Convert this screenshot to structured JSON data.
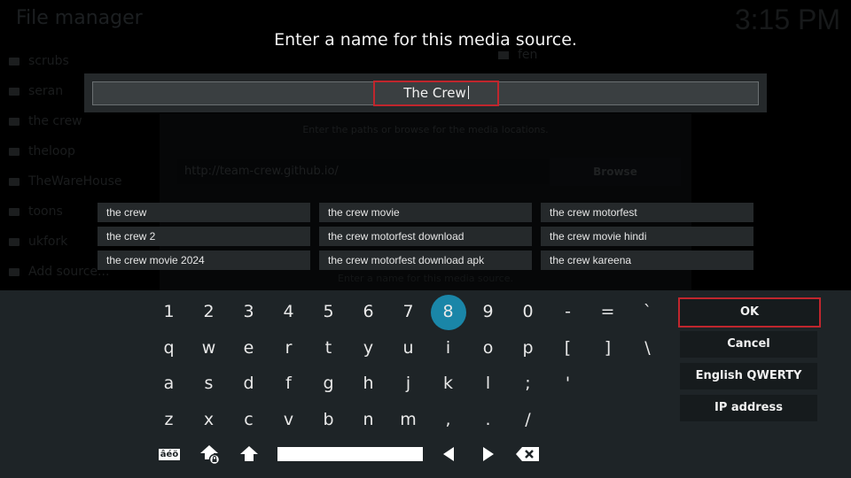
{
  "background": {
    "title": "File manager",
    "clock": "3:15 PM",
    "sources": [
      "scrubs",
      "seran",
      "the crew",
      "theloop",
      "TheWareHouse",
      "toons",
      "ukfork",
      "Add source..."
    ],
    "sources_col2": [
      "fen"
    ],
    "dialog": {
      "hint": "Enter the paths or browse for the media locations.",
      "url": "http://team-crew.github.io/",
      "browse_label": "Browse",
      "name_hint": "Enter a name for this media source."
    }
  },
  "dialog": {
    "prompt": "Enter a name for this media source.",
    "input_value": "The Crew"
  },
  "suggestions": [
    "the crew",
    "the crew movie",
    "the crew motorfest",
    "the crew 2",
    "the crew motorfest download",
    "the crew movie hindi",
    "the crew movie 2024",
    "the crew motorfest download apk",
    "the crew kareena"
  ],
  "keyboard": {
    "rows": [
      [
        "1",
        "2",
        "3",
        "4",
        "5",
        "6",
        "7",
        "8",
        "9",
        "0",
        "-",
        "=",
        "`"
      ],
      [
        "q",
        "w",
        "e",
        "r",
        "t",
        "y",
        "u",
        "i",
        "o",
        "p",
        "[",
        "]",
        "\\"
      ],
      [
        "a",
        "s",
        "d",
        "f",
        "g",
        "h",
        "j",
        "k",
        "l",
        ";",
        "'"
      ],
      [
        "z",
        "x",
        "c",
        "v",
        "b",
        "n",
        "m",
        ",",
        ".",
        "/"
      ]
    ],
    "selected_key": "8",
    "accent_label": "âéö",
    "buttons": {
      "ok": "OK",
      "cancel": "Cancel",
      "layout": "English QWERTY",
      "ip": "IP address"
    }
  },
  "colors": {
    "focus_border": "#c0262d",
    "selected_key": "#1a86a8",
    "keyboard_bg": "#1e2427"
  }
}
